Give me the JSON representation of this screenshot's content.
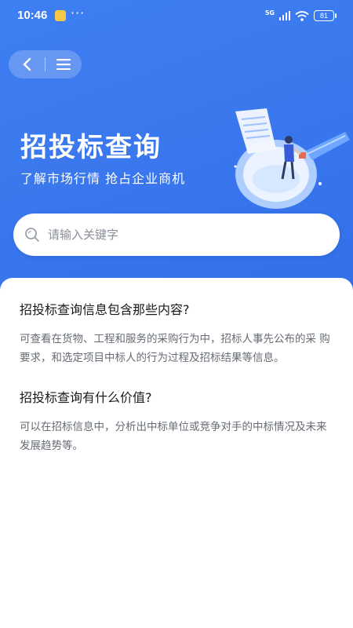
{
  "status_bar": {
    "time": "10:46",
    "dots": "···",
    "network": "5G",
    "battery": "81"
  },
  "nav": {
    "back_icon": "back-arrow-icon",
    "menu_icon": "menu-icon"
  },
  "hero": {
    "title": "招投标查询",
    "subtitle": "了解市场行情 抢占企业商机",
    "illustration": "magnifier-document-person-illustration"
  },
  "search": {
    "placeholder": "请输入关键字",
    "value": "",
    "icon": "search-icon"
  },
  "faq": [
    {
      "question": "招投标查询信息包含那些内容?",
      "answer": "可查看在货物、工程和服务的采购行为中，招标人事先公布的采 购要求，和选定项目中标人的行为过程及招标结果等信息。"
    },
    {
      "question": "招投标查询有什么价值?",
      "answer": "可以在招标信息中，分析出中标单位或竞争对手的中标情况及未来发展趋势等。"
    }
  ],
  "colors": {
    "primary": "#3b78ee",
    "text_dark": "#1a1a1a",
    "text_muted": "#666b73"
  }
}
